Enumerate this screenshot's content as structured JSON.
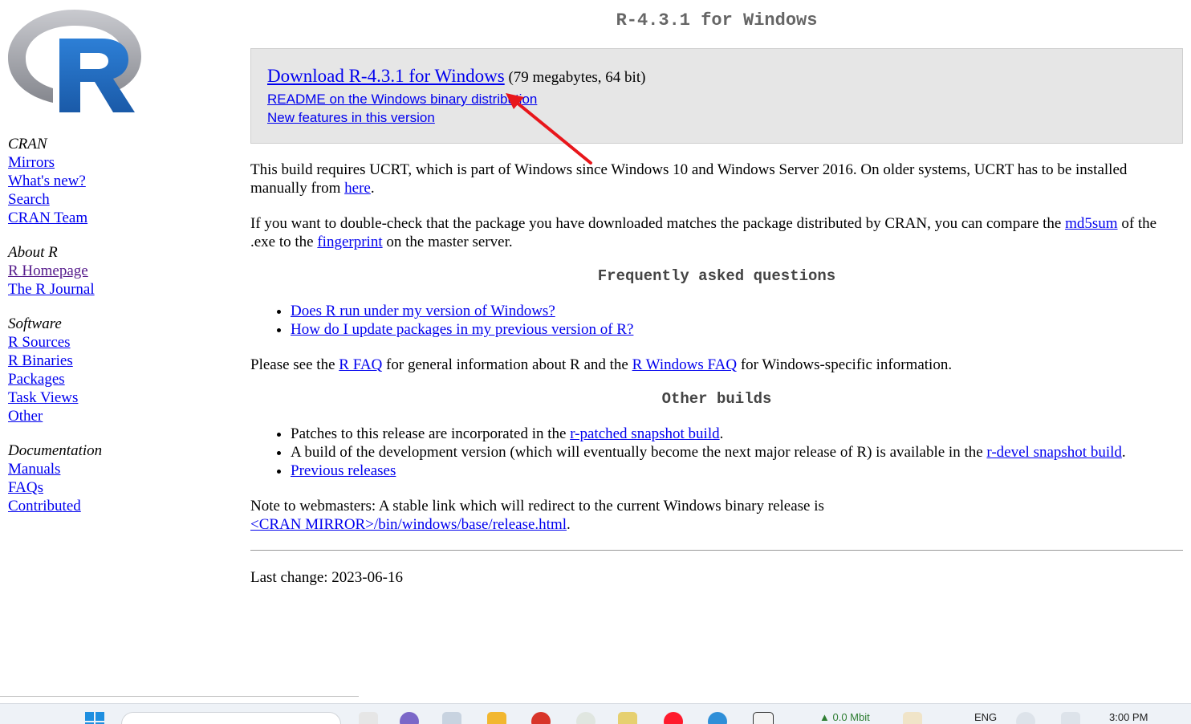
{
  "page": {
    "title": "R-4.3.1 for Windows"
  },
  "logo": {
    "alt": "R logo",
    "letter": "R",
    "ring_color": "#9a9ca3",
    "letter_color": "#1f65b6"
  },
  "sidebar": {
    "groups": [
      {
        "heading": "CRAN",
        "links": [
          "Mirrors",
          "What's new?",
          "Search",
          "CRAN Team"
        ]
      },
      {
        "heading": "About R",
        "links": [
          "R Homepage",
          "The R Journal"
        ]
      },
      {
        "heading": "Software",
        "links": [
          "R Sources",
          "R Binaries",
          "Packages",
          "Task Views",
          "Other"
        ]
      },
      {
        "heading": "Documentation",
        "links": [
          "Manuals",
          "FAQs",
          "Contributed"
        ]
      }
    ]
  },
  "download_box": {
    "main_link": "Download R-4.3.1 for Windows",
    "size_note": "(79 megabytes, 64 bit)",
    "readme_link": "README on the Windows binary distribution",
    "new_features_link": "New features in this version"
  },
  "ucrt": {
    "text_before": "This build requires UCRT, which is part of Windows since Windows 10 and Windows Server 2016. On older systems, UCRT has to be installed manually from ",
    "link": "here",
    "text_after": "."
  },
  "checksum": {
    "text1": "If you want to double-check that the package you have downloaded matches the package distributed by CRAN, you can compare the ",
    "md5_link": "md5sum",
    "text2": " of the .exe to the ",
    "fingerprint_link": "fingerprint",
    "text3": " on the master server."
  },
  "faq": {
    "heading": "Frequently asked questions",
    "items": [
      "Does R run under my version of Windows?",
      "How do I update packages in my previous version of R?"
    ]
  },
  "see_also": {
    "text1": "Please see the ",
    "rfaq_link": "R FAQ",
    "text2": " for general information about R and the ",
    "winfaq_link": "R Windows FAQ",
    "text3": " for Windows-specific information."
  },
  "other_builds": {
    "heading": "Other builds",
    "patched_text": "Patches to this release are incorporated in the ",
    "patched_link": "r-patched snapshot build",
    "patched_end": ".",
    "devel_text": "A build of the development version (which will eventually become the next major release of R) is available in the ",
    "devel_link": "r-devel snapshot build",
    "devel_end": ".",
    "previous_link": "Previous releases"
  },
  "webmasters": {
    "text": "Note to webmasters: A stable link which will redirect to the current Windows binary release is",
    "link": "<CRAN MIRROR>/bin/windows/base/release.html",
    "end": "."
  },
  "last_change": "Last change: 2023-06-16",
  "annotation": {
    "arrow_color": "#e8161b"
  },
  "taskbar": {
    "network": "▲ 0.0 Mbit",
    "language": "ENG",
    "time": "3:00 PM"
  }
}
